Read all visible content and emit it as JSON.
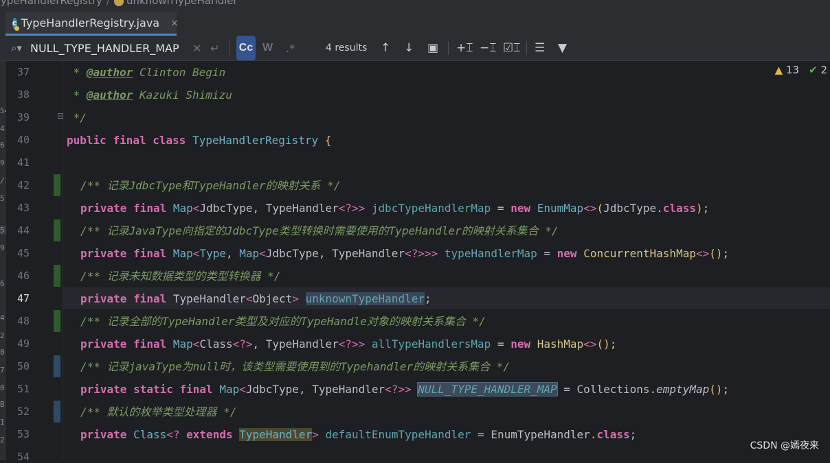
{
  "breadcrumb": {
    "item1": "TypeHandlerRegistry",
    "separator": "/",
    "item2": "unknownTypeHandler"
  },
  "tab": {
    "icon_letter": "c",
    "label": "TypeHandlerRegistry.java",
    "close": "×"
  },
  "search": {
    "value": "NULL_TYPE_HANDLER_MAP",
    "match_case": "Cc",
    "words": "W",
    "regex": ".*",
    "results": "4 results"
  },
  "inspections": {
    "warnings": "13",
    "ok": "2"
  },
  "gutter": {
    "line_numbers": [
      "37",
      "38",
      "39",
      "40",
      "41",
      "42",
      "43",
      "44",
      "45",
      "46",
      "47",
      "48",
      "49",
      "50",
      "51",
      "52",
      "53",
      "54"
    ]
  },
  "sliver": [
    "54",
    "4",
    "6",
    "9",
    "/1",
    "5",
    "5",
    "9",
    "6:",
    "4",
    "2",
    "0",
    "7",
    "0",
    "B",
    "1",
    "2"
  ],
  "code": {
    "l37": {
      "star": " * ",
      "tag": "@author",
      "value": " Clinton Begin"
    },
    "l38": {
      "star": " * ",
      "tag": "@author",
      "value": " Kazuki Shimizu"
    },
    "l39": " */",
    "l40": {
      "kw1": "public",
      "kw2": "final",
      "kw3": "class",
      "name": "TypeHandlerRegistry",
      "brace": "{"
    },
    "l42": "/** 记录JdbcType和TypeHandler的映射关系 */",
    "l43": {
      "kw1": "private",
      "kw2": "final",
      "t1": "Map",
      "a1": "<",
      "t2": "JdbcType",
      "c1": ", ",
      "t3": "TypeHandler",
      "a2": "<?>>",
      "field": "jdbcTypeHandlerMap",
      "eq": " = ",
      "kw3": "new",
      "t4": "EnumMap",
      "a3": "<>",
      "p1": "(",
      "t5": "JdbcType",
      "dot": ".",
      "kw4": "class",
      "p2": ");"
    },
    "l44": "/** 记录JavaType向指定的JdbcType类型转换时需要使用的TypeHandler的映射关系集合 */",
    "l45": {
      "kw1": "private",
      "kw2": "final",
      "t1": "Map",
      "a1": "<",
      "t2": "Type",
      "c1": ", ",
      "t3": "Map",
      "a2": "<",
      "t4": "JdbcType",
      "c2": ", ",
      "t5": "TypeHandler",
      "a3": "<?>>>",
      "field": "typeHandlerMap",
      "eq": " = ",
      "kw3": "new",
      "t6": "ConcurrentHashMap",
      "a4": "<>",
      "p": "();"
    },
    "l46": "/** 记录未知数据类型的类型转换器 */",
    "l47": {
      "kw1": "private",
      "kw2": "final",
      "t1": "TypeHandler",
      "a1": "<",
      "t2": "Object",
      "a2": ">",
      "field": "unknownTypeHandler",
      "end": ";"
    },
    "l48": "/** 记录全部的TypeHandler类型及对应的TypeHandle对象的映射关系集合 */",
    "l49": {
      "kw1": "private",
      "kw2": "final",
      "t1": "Map",
      "a1": "<",
      "t2": "Class",
      "a2": "<?>",
      "c1": ", ",
      "t3": "TypeHandler",
      "a3": "<?>>",
      "field": "allTypeHandlersMap",
      "eq": " = ",
      "kw3": "new",
      "t4": "HashMap",
      "a4": "<>",
      "p": "();"
    },
    "l50": "/** 记录javaType为null时，该类型需要使用到的Typehandler的映射关系集合 */",
    "l51": {
      "kw1": "private",
      "kw2": "static",
      "kw3": "final",
      "t1": "Map",
      "a1": "<",
      "t2": "JdbcType",
      "c1": ", ",
      "t3": "TypeHandler",
      "a2": "<?>>",
      "field": "NULL_TYPE_HANDLER_MAP",
      "eq": " = ",
      "t4": "Collections",
      "dot": ".",
      "m": "emptyMap",
      "p": "();"
    },
    "l52": "/** 默认的枚举类型处理器 */",
    "l53": {
      "kw1": "private",
      "t1": "Class",
      "a1": "<? ",
      "kw2": "extends",
      "t2": "TypeHandler",
      "a2": ">",
      "field": "defaultEnumTypeHandler",
      "eq": " = ",
      "t3": "EnumTypeHandler",
      "dot": ".",
      "kw3": "class",
      "end": ";"
    }
  },
  "watermark": "CSDN @嫣夜来",
  "colors": {
    "background": "#1e1f22",
    "keyword": "#cf8e6d",
    "comment": "#7a9a63",
    "field": "#5fa4b0",
    "accent": "#4a88c7"
  }
}
